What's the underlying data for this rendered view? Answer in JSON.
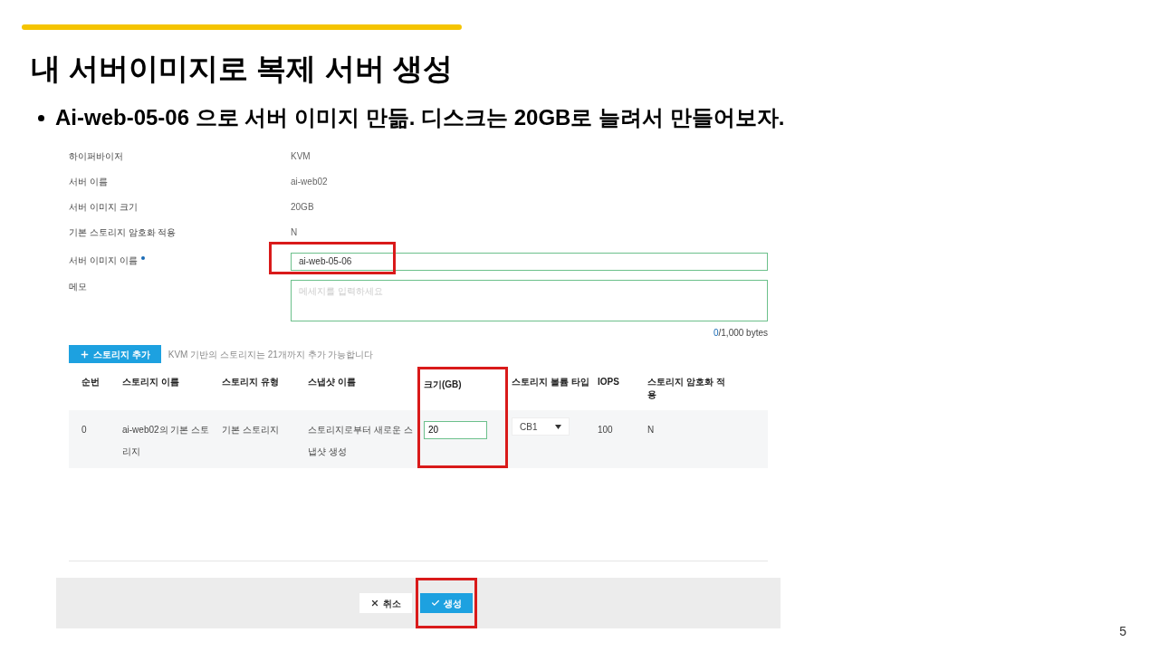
{
  "slide": {
    "title": "내 서버이미지로 복제 서버 생성",
    "bullet": "Ai-web-05-06 으로 서버 이미지 만듦.  디스크는 20GB로 늘려서 만들어보자.",
    "page_number": "5"
  },
  "form": {
    "fields": [
      {
        "kind": "text",
        "label": "하이퍼바이저",
        "value": "KVM"
      },
      {
        "kind": "text",
        "label": "서버 이름",
        "value": "ai-web02"
      },
      {
        "kind": "text",
        "label": "서버 이미지 크기",
        "value": "20GB"
      },
      {
        "kind": "text",
        "label": "기본 스토리지 암호화 적용",
        "value": "N"
      },
      {
        "kind": "input",
        "label": "서버 이미지 이름",
        "required": true,
        "value": "ai-web-05-06",
        "highlighted": true
      },
      {
        "kind": "textarea",
        "label": "메모",
        "placeholder": "메세지를 입력하세요"
      }
    ],
    "counter": {
      "count": "0",
      "limit": "/1,000 bytes"
    }
  },
  "storage": {
    "add_button": "스토리지 추가",
    "hint": "KVM 기반의 스토리지는 21개까지 추가 가능합니다",
    "columns": [
      {
        "label": "순번",
        "highlighted": false
      },
      {
        "label": "스토리지 이름",
        "highlighted": false
      },
      {
        "label": "스토리지 유형",
        "highlighted": false
      },
      {
        "label": "스냅샷 이름",
        "highlighted": false
      },
      {
        "label": "크기(GB)",
        "highlighted": true
      },
      {
        "label": "스토리지 볼륨 타입",
        "highlighted": false
      },
      {
        "label": "IOPS",
        "highlighted": false
      },
      {
        "label": "스토리지 암호화 적용",
        "highlighted": false
      }
    ],
    "rows": [
      [
        {
          "kind": "text",
          "value": "0"
        },
        {
          "kind": "text",
          "value": "ai-web02의 기본 스토리지"
        },
        {
          "kind": "text",
          "value": "기본 스토리지"
        },
        {
          "kind": "text",
          "value": "스토리지로부터 새로운 스냅샷 생성"
        },
        {
          "kind": "input",
          "value": "20"
        },
        {
          "kind": "select",
          "value": "CB1"
        },
        {
          "kind": "text",
          "value": "100"
        },
        {
          "kind": "text",
          "value": "N"
        }
      ]
    ]
  },
  "footer": {
    "buttons": [
      {
        "kind": "secondary",
        "label": "취소",
        "highlighted": false
      },
      {
        "kind": "primary",
        "label": "생성",
        "highlighted": true
      }
    ]
  }
}
